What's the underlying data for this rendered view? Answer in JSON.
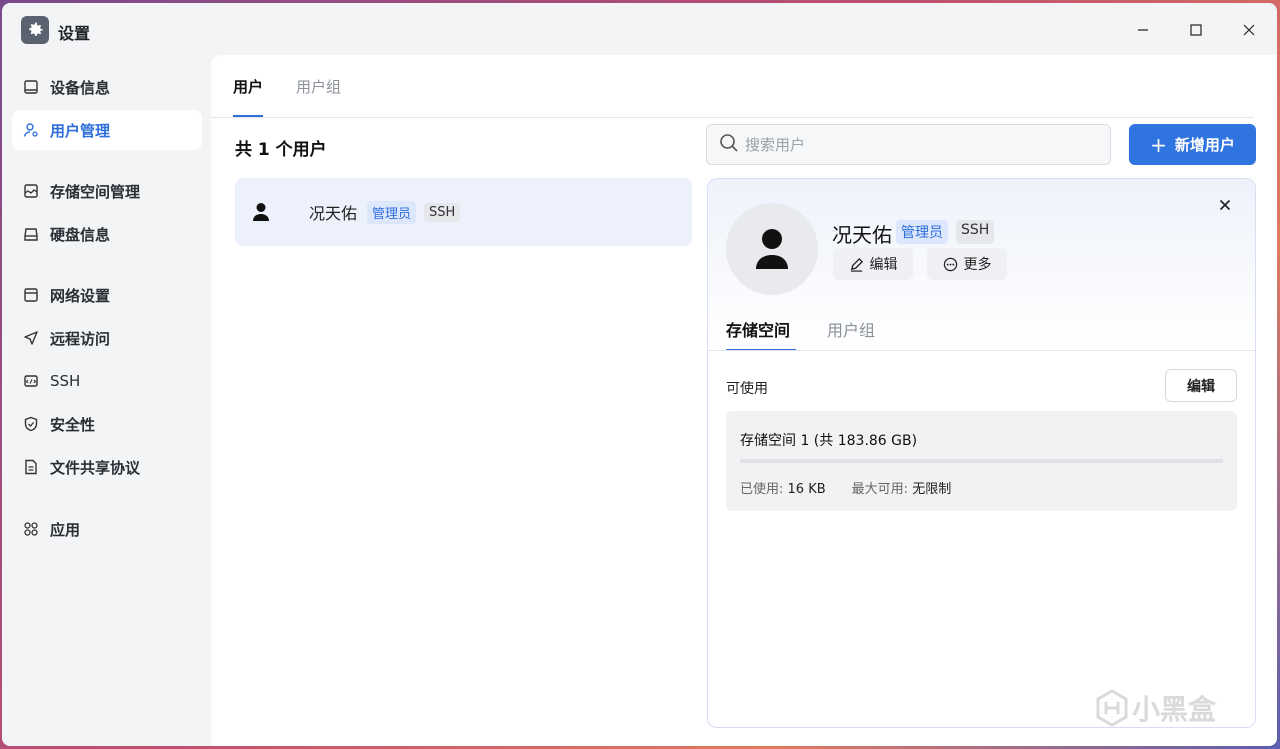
{
  "window": {
    "title": "设置",
    "controls": {
      "minimize": "—",
      "maximize": "☐",
      "close": "✕"
    }
  },
  "sidebar": {
    "items": [
      {
        "label": "设备信息",
        "icon": "device-icon"
      },
      {
        "label": "用户管理",
        "icon": "user-manage-icon",
        "active": true
      },
      {
        "label": "存储空间管理",
        "icon": "storage-icon"
      },
      {
        "label": "硬盘信息",
        "icon": "disk-icon"
      },
      {
        "label": "网络设置",
        "icon": "network-icon"
      },
      {
        "label": "远程访问",
        "icon": "remote-icon"
      },
      {
        "label": "SSH",
        "icon": "ssh-icon"
      },
      {
        "label": "安全性",
        "icon": "shield-icon"
      },
      {
        "label": "文件共享协议",
        "icon": "file-share-icon"
      },
      {
        "label": "应用",
        "icon": "apps-icon"
      }
    ]
  },
  "main": {
    "tabs": [
      {
        "label": "用户",
        "active": true
      },
      {
        "label": "用户组",
        "active": false
      }
    ],
    "count_title": "共 1 个用户",
    "search": {
      "placeholder": "搜索用户",
      "value": ""
    },
    "add_button": {
      "plus": "+",
      "label": "新增用户"
    },
    "users": [
      {
        "name": "况天佑",
        "badge_admin": "管理员",
        "badge_ssh": "SSH"
      }
    ]
  },
  "detail": {
    "name": "况天佑",
    "badge_admin": "管理员",
    "badge_ssh": "SSH",
    "edit_label": "编辑",
    "more_label": "更多",
    "close": "✕",
    "tabs": [
      {
        "label": "存储空间",
        "active": true
      },
      {
        "label": "用户组",
        "active": false
      }
    ],
    "available_label": "可使用",
    "edit_button": "编辑",
    "storage": {
      "title": "存储空间 1 (共 183.86 GB)",
      "used_label": "已使用:",
      "used_value": "16 KB",
      "max_label": "最大可用:",
      "max_value": "无限制",
      "used_fraction": 0.0
    }
  },
  "watermark": "小黑盒",
  "colors": {
    "accent": "#2f74df",
    "admin_badge": "#2f6fdc"
  }
}
